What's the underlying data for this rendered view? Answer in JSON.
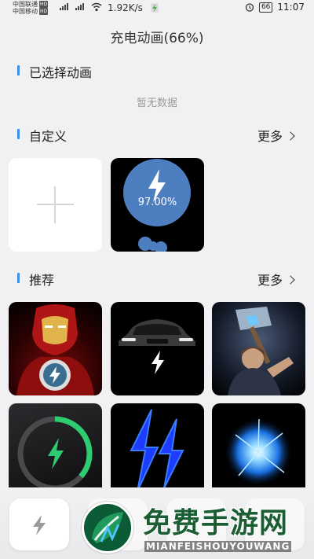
{
  "status_bar": {
    "carrier1": "中国联通",
    "carrier2": "中国移动",
    "hd_badge": "HD",
    "net_type": "4G",
    "speed": "1.92K/s",
    "battery": "66",
    "time": "11:07"
  },
  "page": {
    "title": "充电动画(66%)"
  },
  "selected": {
    "title": "已选择动画",
    "empty": "暂无数据"
  },
  "custom": {
    "title": "自定义",
    "more": "更多",
    "add_icon": "plus-icon",
    "tile": {
      "percent": "97.00%",
      "accent": "#4d7fc0"
    }
  },
  "recommended": {
    "title": "推荐",
    "more": "更多",
    "tiles": [
      {
        "name": "ironman-animation"
      },
      {
        "name": "car-animation"
      },
      {
        "name": "thor-animation"
      },
      {
        "name": "green-ring-animation"
      },
      {
        "name": "blue-bolt-animation"
      },
      {
        "name": "plasma-ball-animation"
      }
    ]
  },
  "watermark": {
    "cn": "免费手游网",
    "en": "MIANFEISHOUYOUWANG"
  },
  "colors": {
    "accent": "#3a8fe3",
    "bolt_green": "#2ecc71",
    "bolt_blue": "#1e3cff"
  }
}
